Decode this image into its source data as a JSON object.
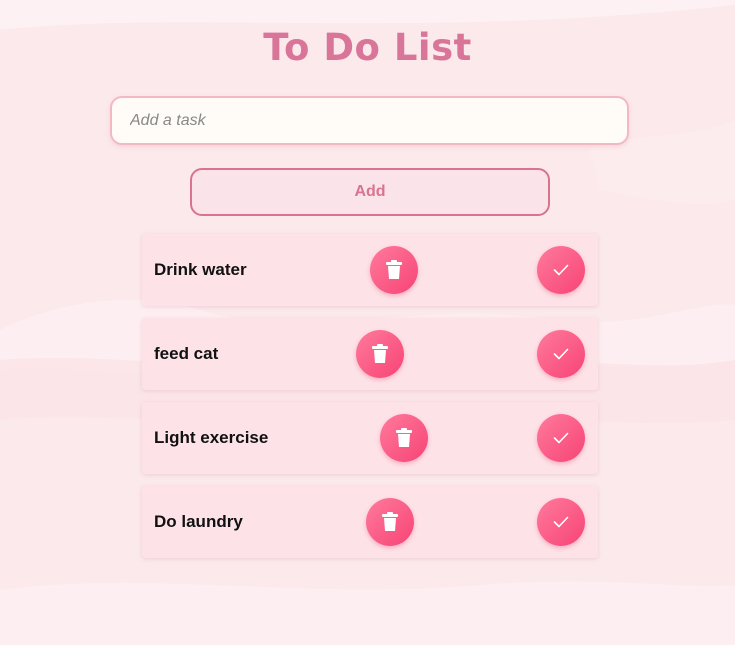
{
  "header": {
    "title": "To Do List"
  },
  "form": {
    "input_placeholder": "Add a task",
    "input_value": "",
    "add_label": "Add"
  },
  "todos": [
    {
      "text": "Drink water",
      "delete_icon": "trash-icon",
      "complete_icon": "checkmark-icon"
    },
    {
      "text": "feed cat",
      "delete_icon": "trash-icon",
      "complete_icon": "checkmark-icon"
    },
    {
      "text": "Light exercise",
      "delete_icon": "trash-icon",
      "complete_icon": "checkmark-icon"
    },
    {
      "text": "Do laundry",
      "delete_icon": "trash-icon",
      "complete_icon": "checkmark-icon"
    }
  ],
  "colors": {
    "accent": "#d97598",
    "button_gradient_start": "#ff7a9c",
    "button_gradient_end": "#f74476",
    "item_background": "#fde3e8",
    "page_background": "#fbe9ec"
  }
}
